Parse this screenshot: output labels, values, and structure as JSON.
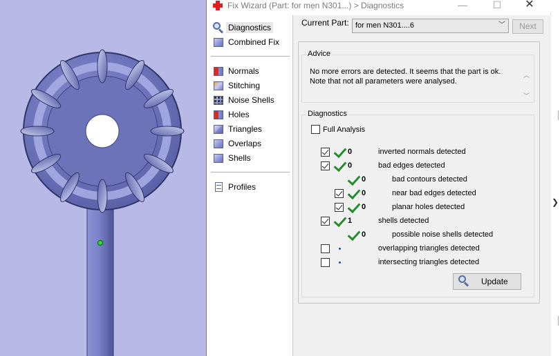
{
  "window": {
    "title": "Fix Wizard (Part: for men N301...) > Diagnostics",
    "min_glyph": "—",
    "max_glyph": "☐",
    "close_glyph": "✕"
  },
  "nav": {
    "items": [
      {
        "label": "Diagnostics",
        "icon": "magnifier-icon"
      },
      {
        "label": "Combined Fix",
        "icon": "cube-icon"
      },
      {
        "label": "Normals",
        "icon": "normals-cube-icon"
      },
      {
        "label": "Stitching",
        "icon": "stitching-cube-icon"
      },
      {
        "label": "Noise Shells",
        "icon": "noise-shells-icon"
      },
      {
        "label": "Holes",
        "icon": "holes-cube-icon"
      },
      {
        "label": "Triangles",
        "icon": "triangles-icon"
      },
      {
        "label": "Overlaps",
        "icon": "overlaps-icon"
      },
      {
        "label": "Shells",
        "icon": "shells-icon"
      },
      {
        "label": "Profiles",
        "icon": "profiles-doc-icon"
      }
    ],
    "selected": "Diagnostics"
  },
  "main": {
    "current_part_label": "Current Part:",
    "current_part_value": "for men N301....6",
    "next_label": "Next",
    "advice": {
      "title": "Advice",
      "line1": "No more errors are detected. It seems that the part is ok.",
      "line2": "Note that not all parameters were analysed."
    },
    "diagnostics": {
      "title": "Diagnostics",
      "full_analysis_label": "Full Analysis",
      "full_analysis_checked": false,
      "rows": [
        {
          "label": "inverted normals detected",
          "count": "0",
          "checked": true,
          "status": "ok"
        },
        {
          "label": "bad edges detected",
          "count": "0",
          "checked": true,
          "status": "ok"
        },
        {
          "label": "bad contours detected",
          "count": "0",
          "checked": null,
          "status": "ok"
        },
        {
          "label": "near bad edges detected",
          "count": "0",
          "checked": true,
          "status": "ok"
        },
        {
          "label": "planar holes detected",
          "count": "0",
          "checked": true,
          "status": "ok"
        },
        {
          "label": "shells detected",
          "count": "1",
          "checked": true,
          "status": "ok"
        },
        {
          "label": "possible noise shells detected",
          "count": "0",
          "checked": null,
          "status": "ok"
        },
        {
          "label": "overlapping triangles detected",
          "count": "",
          "checked": false,
          "status": "pending"
        },
        {
          "label": "intersecting triangles detected",
          "count": "",
          "checked": false,
          "status": "pending"
        }
      ]
    },
    "update_label": "Update"
  },
  "colors": {
    "viewport_bg": "#b9b9e8",
    "part_fill": "#6e75b8",
    "check_green": "#238c2f",
    "close_icon_red": "#e02020"
  }
}
